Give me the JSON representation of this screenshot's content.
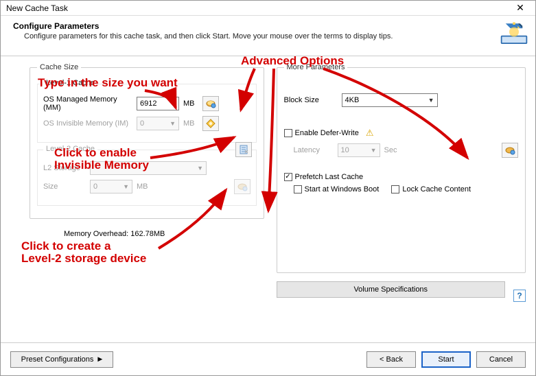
{
  "window": {
    "title": "New Cache Task",
    "close_glyph": "✕"
  },
  "header": {
    "title": "Configure Parameters",
    "subtitle": "Configure parameters for this cache task, and then click Start. Move your mouse over the terms to display tips."
  },
  "cache_size": {
    "legend": "Cache Size",
    "l1": {
      "legend": "Level-1 Cache",
      "mm_label": "OS Managed Memory (MM)",
      "mm_value": "6912",
      "mm_unit": "MB",
      "im_label": "OS Invisible Memory (IM)",
      "im_value": "0",
      "im_unit": "MB"
    },
    "l2": {
      "legend": "Level-2 Cache",
      "storage_label": "L2 Storage",
      "storage_value": "",
      "size_label": "Size",
      "size_value": "0",
      "size_unit": "MB"
    },
    "overhead_label": "Memory Overhead:",
    "overhead_value": "162.78MB"
  },
  "more": {
    "legend": "More Parameters",
    "block_label": "Block Size",
    "block_value": "4KB",
    "defer_label": "Enable Defer-Write",
    "latency_label": "Latency",
    "latency_value": "10",
    "latency_unit": "Sec",
    "prefetch_label": "Prefetch Last Cache",
    "startboot_label": "Start at Windows Boot",
    "lock_label": "Lock Cache Content",
    "volspec_label": "Volume Specifications",
    "help_glyph": "?"
  },
  "footer": {
    "preset_label": "Preset Configurations",
    "back_label": "< Back",
    "start_label": "Start",
    "cancel_label": "Cancel"
  },
  "annotations": {
    "adv": "Advanced Options",
    "type": "Type in the size you want",
    "inv1": "Click to enable",
    "inv2": "Invisible Memory",
    "l2a": "Click to create a",
    "l2b": "Level-2 storage device"
  }
}
